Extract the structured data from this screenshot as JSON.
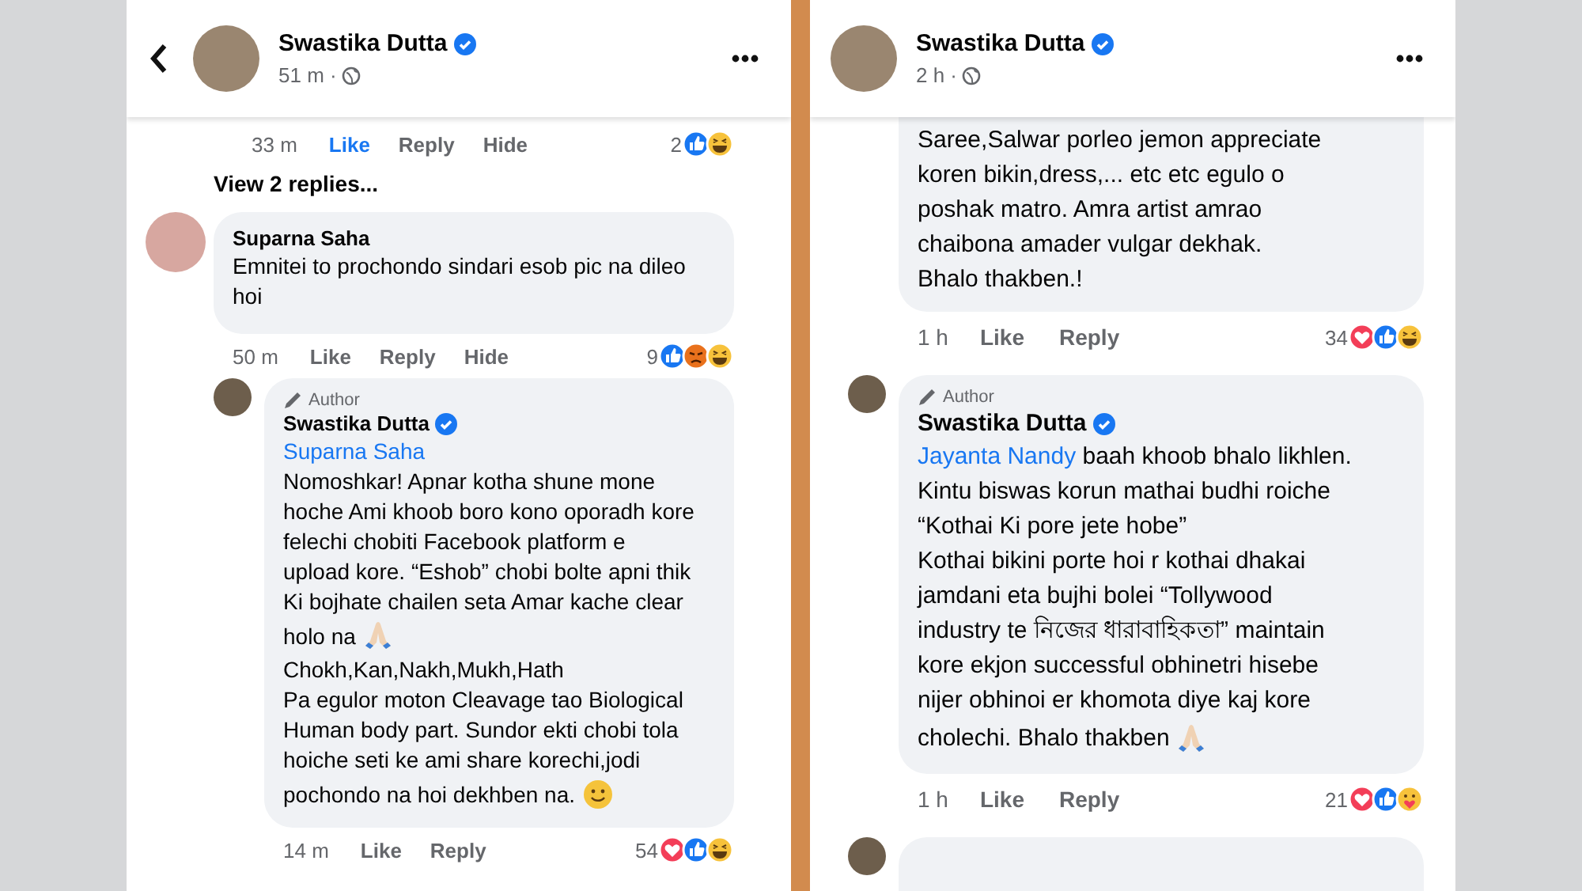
{
  "panels": [
    {
      "header": {
        "name": "Swastika Dutta",
        "verified": true,
        "time": "51 m ·"
      },
      "items": [
        {
          "kind": "actions",
          "time": "33 m",
          "actions": [
            {
              "label": "Like",
              "selected": true
            },
            {
              "label": "Reply",
              "selected": false
            },
            {
              "label": "Hide",
              "selected": false
            }
          ],
          "count": "2",
          "reactions": [
            {
              "kind": "like"
            },
            {
              "kind": "haha"
            }
          ]
        },
        {
          "kind": "link",
          "text": "View 2 replies..."
        },
        {
          "kind": "comment",
          "reply": false,
          "name": "Suparna Saha",
          "lines": [
            {
              "text": "Emnitei to prochondo sindari esob pic na dileo"
            },
            {
              "text": "hoi"
            }
          ],
          "time": "50 m",
          "actions": [
            {
              "label": "Like",
              "selected": false
            },
            {
              "label": "Reply",
              "selected": false
            },
            {
              "label": "Hide",
              "selected": false
            }
          ],
          "count": "9",
          "reactions": [
            {
              "kind": "like"
            },
            {
              "kind": "angry"
            },
            {
              "kind": "haha"
            }
          ]
        },
        {
          "kind": "comment",
          "reply": true,
          "badge": "Author",
          "name": "Swastika Dutta",
          "verified": true,
          "lines": [
            {
              "mention": "Suparna Saha"
            },
            {
              "text": "Nomoshkar! Apnar kotha shune mone"
            },
            {
              "text": "hoche Ami khoob boro kono oporadh kore"
            },
            {
              "text": "felechi chobiti Facebook platform e"
            },
            {
              "text": "upload kore. “Eshob” chobi bolte apni thik"
            },
            {
              "text": "Ki bojhate chailen seta Amar kache clear"
            },
            {
              "text": "holo na",
              "icon": {
                "kind": "pray"
              }
            },
            {
              "text": "Chokh,Kan,Nakh,Mukh,Hath"
            },
            {
              "text": "Pa egulor moton Cleavage tao Biological"
            },
            {
              "text": "Human body part. Sundor ekti chobi tola"
            },
            {
              "text": "hoiche seti ke ami share korechi,jodi"
            },
            {
              "text": "pochondo na hoi dekhben na.",
              "icon": {
                "kind": "smile"
              }
            }
          ],
          "time": "14 m",
          "actions": [
            {
              "label": "Like",
              "selected": false
            },
            {
              "label": "Reply",
              "selected": false
            }
          ],
          "count": "54",
          "reactions": [
            {
              "kind": "love"
            },
            {
              "kind": "like"
            },
            {
              "kind": "haha"
            }
          ]
        }
      ]
    },
    {
      "header": {
        "name": "Swastika Dutta",
        "verified": true,
        "time": "2 h ·"
      },
      "items": [
        {
          "kind": "comment",
          "reply": true,
          "lines": [
            {
              "text": "Saree,Salwar porleo jemon appreciate"
            },
            {
              "text": "koren bikin,dress,... etc etc egulo o"
            },
            {
              "text": "poshak matro. Amra artist amrao"
            },
            {
              "text": "chaibona amader vulgar dekhak."
            },
            {
              "text": "Bhalo thakben.!"
            }
          ],
          "time": "1 h",
          "actions": [
            {
              "label": "Like",
              "selected": false
            },
            {
              "label": "Reply",
              "selected": false
            }
          ],
          "count": "34",
          "reactions": [
            {
              "kind": "love"
            },
            {
              "kind": "like"
            },
            {
              "kind": "haha"
            }
          ]
        },
        {
          "kind": "comment",
          "reply": true,
          "badge": "Author",
          "name": "Swastika Dutta",
          "verified": true,
          "lines": [
            {
              "mention": "Jayanta Nandy",
              "text": " baah khoob bhalo likhlen."
            },
            {
              "text": "Kintu biswas korun mathai budhi roiche"
            },
            {
              "text": "“Kothai Ki pore jete hobe”"
            },
            {
              "text": "Kothai bikini porte hoi r kothai dhakai"
            },
            {
              "text": "jamdani eta bujhi bolei “Tollywood"
            },
            {
              "text": "industry te নিজের ধারাবাহিকতা” maintain"
            },
            {
              "text": "kore ekjon successful obhinetri hisebe"
            },
            {
              "text": "nijer obhinoi er khomota diye kaj kore"
            },
            {
              "text": "cholechi. Bhalo thakben",
              "icon": {
                "kind": "pray"
              }
            }
          ],
          "time": "1 h",
          "actions": [
            {
              "label": "Like",
              "selected": false
            },
            {
              "label": "Reply",
              "selected": false
            }
          ],
          "count": "21",
          "reactions": [
            {
              "kind": "love"
            },
            {
              "kind": "like"
            },
            {
              "kind": "care"
            }
          ]
        },
        {
          "kind": "comment",
          "reply": true
        }
      ]
    }
  ]
}
